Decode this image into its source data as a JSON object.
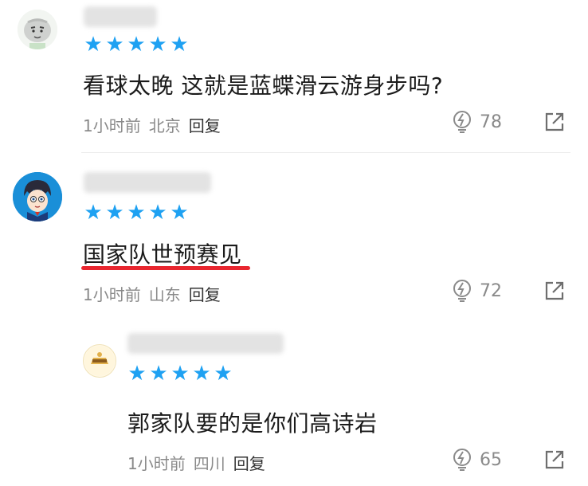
{
  "comments": [
    {
      "rating": 5,
      "text": "看球太晚 这就是蓝蝶滑云游身步吗?",
      "time": "1小时前",
      "location": "北京",
      "reply_label": "回复",
      "likes": "78",
      "avatar_icon": "grey-cartoon-face-icon"
    },
    {
      "rating": 5,
      "text": "国家队世预赛见",
      "time": "1小时前",
      "location": "山东",
      "reply_label": "回复",
      "likes": "72",
      "avatar_icon": "anime-character-icon",
      "highlight_color": "#e8262f"
    },
    {
      "rating": 5,
      "text": "郭家队要的是你们高诗岩",
      "time": "1小时前",
      "location": "四川",
      "reply_label": "回复",
      "likes": "65",
      "avatar_icon": "yellow-badge-icon"
    }
  ],
  "colors": {
    "star": "#1ea1f2",
    "meta": "#8a8a8a",
    "highlight": "#e8262f"
  }
}
